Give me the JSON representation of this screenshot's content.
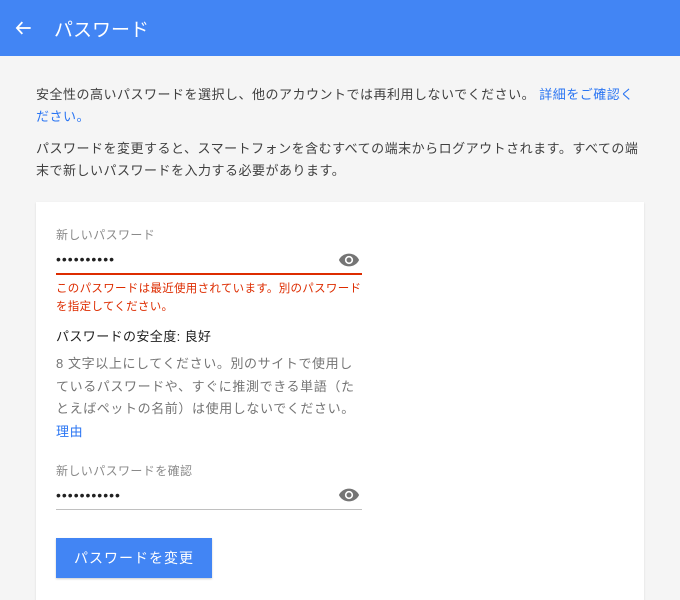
{
  "header": {
    "title": "パスワード"
  },
  "intro": {
    "line1_a": "安全性の高いパスワードを選択し、他のアカウントでは再利用しないでください。",
    "line1_link": "詳細をご確認ください。",
    "line2": "パスワードを変更すると、スマートフォンを含むすべての端末からログアウトされます。すべての端末で新しいパスワードを入力する必要があります。"
  },
  "form": {
    "new_password_label": "新しいパスワード",
    "new_password_value": "••••••••••",
    "error_message": "このパスワードは最近使用されています。別のパスワードを指定してください。",
    "strength_label_prefix": "パスワードの安全度: ",
    "strength_value": "良好",
    "hint_text": "8 文字以上にしてください。別のサイトで使用しているパスワードや、すぐに推測できる単語（たとえばペットの名前）は使用しないでください。",
    "hint_link": "理由",
    "confirm_label": "新しいパスワードを確認",
    "confirm_value": "•••••••••••",
    "submit_label": "パスワードを変更"
  }
}
